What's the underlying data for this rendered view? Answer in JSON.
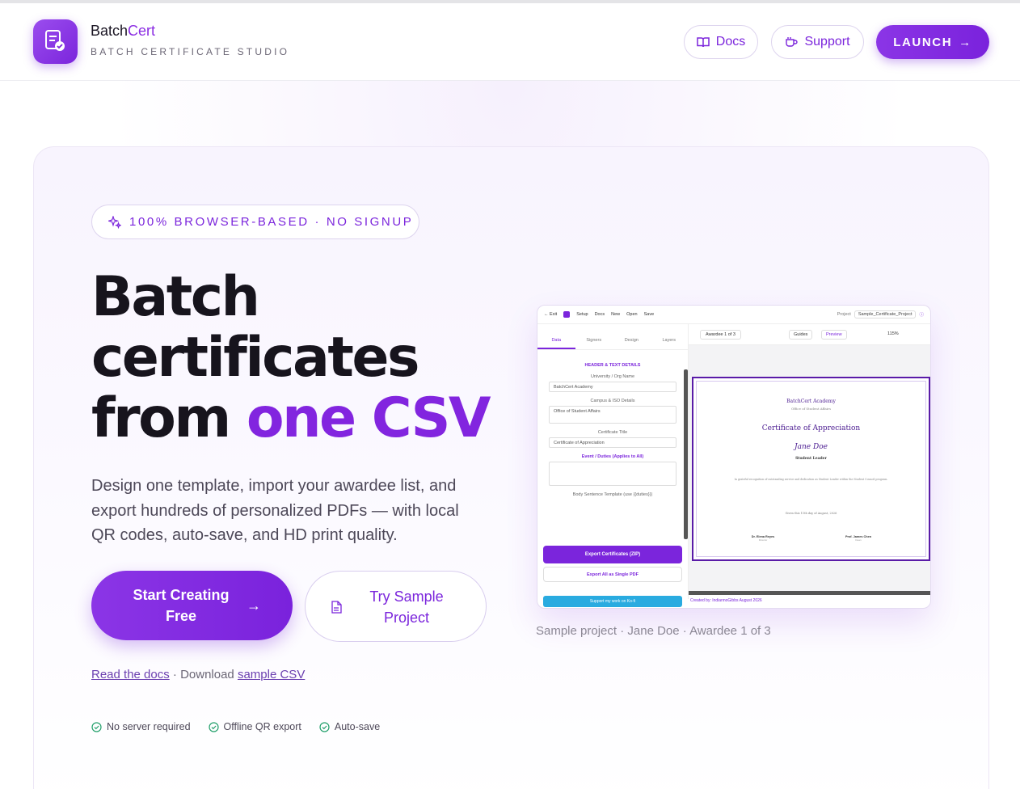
{
  "brand": {
    "name_main": "Batch",
    "name_accent": "Cert",
    "subtitle": "BATCH CERTIFICATE STUDIO"
  },
  "header": {
    "docs_label": "Docs",
    "support_label": "Support",
    "launch_label": "LAUNCH"
  },
  "hero": {
    "badge": "100% BROWSER-BASED · NO SIGNUP",
    "title_line1": "Batch",
    "title_line2": "certificates",
    "title_line3_plain": "from ",
    "title_line3_accent": "one CSV",
    "lead": "Design one template, import your awardee list, and export hundreds of personalized PDFs — with local QR codes, auto-save, and HD print quality.",
    "cta_primary": "Start Creating Free",
    "cta_secondary": "Try Sample Project",
    "link_docs": "Read the docs",
    "link_sep": " · Download ",
    "link_csv": "sample CSV",
    "features": [
      "No server required",
      "Offline QR export",
      "Auto-save"
    ]
  },
  "mock": {
    "topbar": {
      "exit": "Exit",
      "setup": "Setup",
      "docs": "Docs",
      "new": "New",
      "open": "Open",
      "save": "Save",
      "project_label": "Project",
      "project_name": "Sample_Certificate_Project"
    },
    "tabs": [
      "Data",
      "Signers",
      "Design",
      "Layers"
    ],
    "section_title": "HEADER & TEXT DETAILS",
    "fields": {
      "org_label": "University / Org Name",
      "org_value": "BatchCert Academy",
      "campus_label": "Campus & ISO Details",
      "campus_value": "Office of Student Affairs",
      "cert_title_label": "Certificate Title",
      "cert_title_value": "Certificate of Appreciation",
      "event_label": "Event / Duties (Applies to All)",
      "body_label": "Body Sentence Template (use {{duties}})"
    },
    "export_zip": "Export Certificates (ZIP)",
    "export_pdf": "Export All as Single PDF",
    "support_kofi": "Support my work on Ko-fi",
    "toolbar": {
      "awardee": "Awardee 1 of 3",
      "guides": "Guides",
      "preview": "Preview",
      "zoom": "115%"
    },
    "certificate": {
      "org": "BatchCert Academy",
      "office": "Office of Student Affairs",
      "title": "Certificate of Appreciation",
      "name": "Jane Doe",
      "role": "Student Leader",
      "body": "In grateful recognition of outstanding service and dedication as Student Leader within the Student Council program.",
      "date": "Given this 11th day of August, 2026",
      "signer1_name": "Dr. Elena Reyes",
      "signer1_role": "Director",
      "signer2_name": "Prof. James Chen",
      "signer2_role": "Dean"
    },
    "footer": "Created by: IndiannoGibbs August 2026"
  },
  "caption": "Sample project · Jane Doe · Awardee 1 of 3",
  "colors": {
    "accent": "#7b25dc",
    "text": "#17141d"
  }
}
